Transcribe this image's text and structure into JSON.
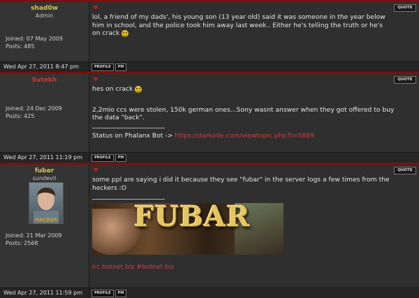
{
  "posts": [
    {
      "username": "shad0w",
      "username_color": "#d4c65a",
      "rank": "Admin",
      "joined": "Joined: 07 May 2009",
      "posts": "Posts: 485",
      "text": "lol, a friend of my dads', his young son (13 year old) said it was someone in the year below him in school, and the police took him away last week.. Either he's telling the truth or he's on crack",
      "date": "Wed Apr 27, 2011 8:47 pm"
    },
    {
      "username": "Sutekh",
      "username_color": "#c93a35",
      "joined": "Joined: 24 Dec 2009",
      "posts": "Posts: 425",
      "text": "hes on crack",
      "text2": "2,2mio ccs were stolen, 150k german ones...Sony wasnt answer when they got offered to buy the data \"back\".",
      "sig_prefix": "Status on Phalanx Bot -> ",
      "sig_link": "https://darkode.com/viewtopic.php?t=5889",
      "date": "Wed Apr 27, 2011 11:19 pm"
    },
    {
      "username": "fubar",
      "username_color": "#d4c65a",
      "rank": "sundevil",
      "avatar_text": "HACKER",
      "joined": "Joined: 21 Mar 2009",
      "posts": "Posts: 2568",
      "text": "some ppl are saying i did it because they see \"fubar\" in the server logs a few times from the heckers :O",
      "banner_text": "FUBAR",
      "sig_link": "irc.botnet.biz #botnet.biz",
      "date": "Wed Apr 27, 2011 11:59 pm"
    }
  ],
  "buttons": {
    "quote": "QUOTE",
    "profile": "PROFILE",
    "pm": "PM"
  },
  "colors": {
    "accent_red": "#7a1010",
    "link": "#c9423a"
  }
}
